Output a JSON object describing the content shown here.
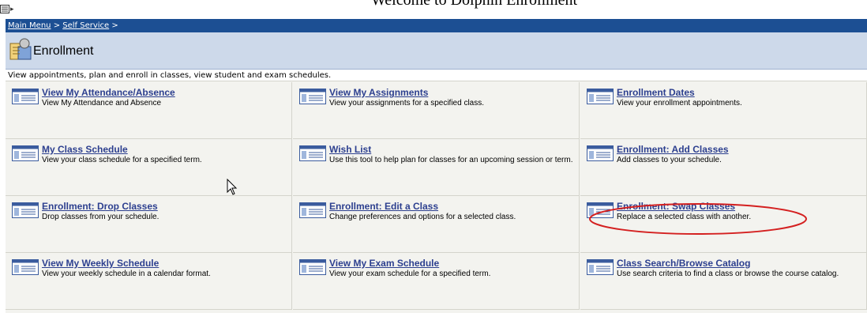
{
  "doc_title": "Welcome to Dolphin Enrollment",
  "breadcrumb": {
    "main_menu": "Main Menu",
    "sep1": " > ",
    "self_service": "Self Service",
    "sep2": " >"
  },
  "header": {
    "title": "Enrollment"
  },
  "description": "View appointments, plan and enroll in classes, view student and exam schedules.",
  "tiles": [
    {
      "title": "View My Attendance/Absence",
      "sub": "View My Attendance and Absence"
    },
    {
      "title": "View My Assignments",
      "sub": "View your assignments for a specified class."
    },
    {
      "title": "Enrollment Dates",
      "sub": "View your enrollment appointments."
    },
    {
      "title": "My Class Schedule",
      "sub": "View your class schedule for a specified term."
    },
    {
      "title": "Wish List",
      "sub": "Use this tool to help plan for classes for an upcoming session or term."
    },
    {
      "title": "Enrollment: Add Classes",
      "sub": "Add classes to your schedule."
    },
    {
      "title": "Enrollment: Drop Classes",
      "sub": "Drop classes from your schedule."
    },
    {
      "title": "Enrollment: Edit a Class",
      "sub": "Change preferences and options for a selected class."
    },
    {
      "title": "Enrollment: Swap Classes",
      "sub": "Replace a selected class with another."
    },
    {
      "title": "View My Weekly Schedule",
      "sub": "View your weekly schedule in a calendar format."
    },
    {
      "title": "View My Exam Schedule",
      "sub": "View your exam schedule for a specified term."
    },
    {
      "title": "Class Search/Browse Catalog",
      "sub": "Use search criteria to find a class or browse the course catalog."
    }
  ],
  "colors": {
    "breadcrumb_bg": "#1c4f93",
    "header_bg": "#cdd9ea",
    "link": "#2c3f8f",
    "highlight": "#d42020"
  },
  "icons": {
    "tile": "window-icon",
    "header": "enrollment-icon",
    "top": "menu-icon"
  }
}
